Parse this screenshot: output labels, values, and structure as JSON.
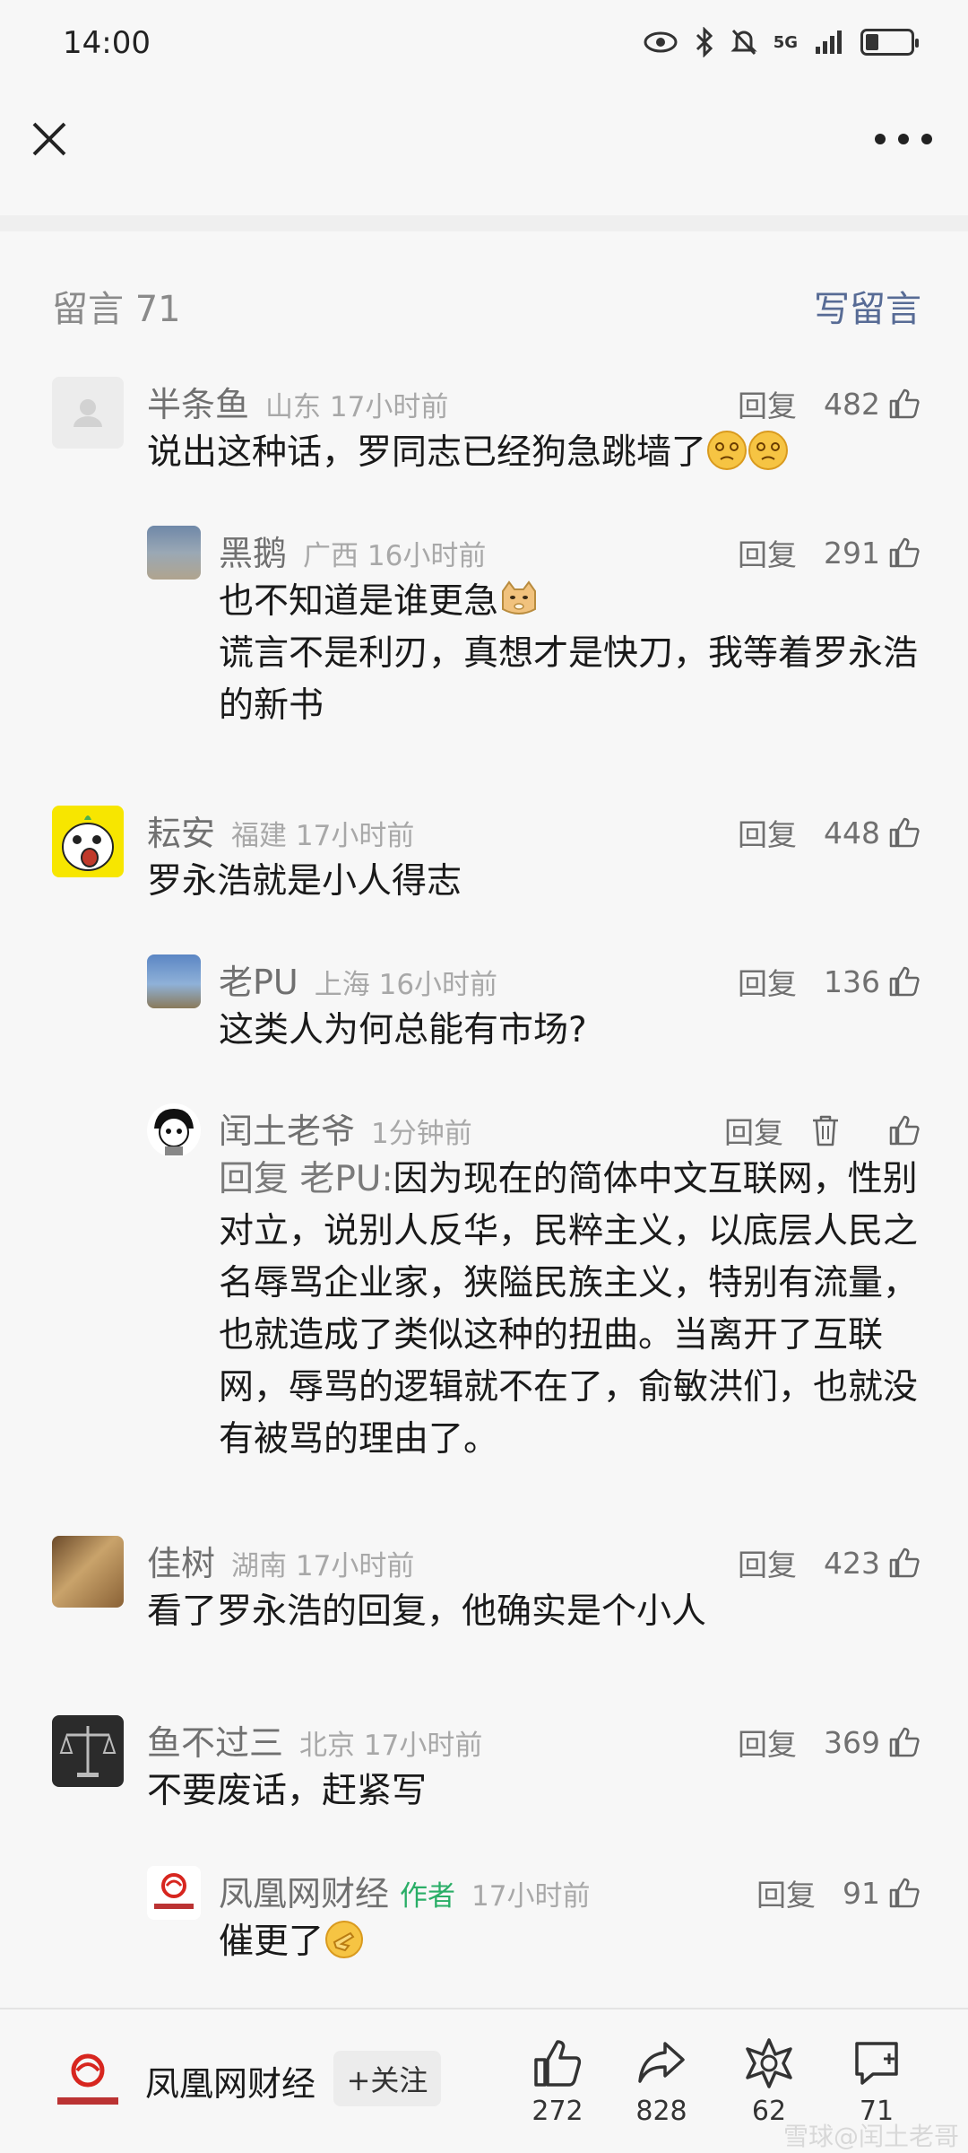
{
  "status_bar": {
    "time": "14:00",
    "network": "5G"
  },
  "comments_section": {
    "title": "留言 71",
    "write_label": "写留言"
  },
  "comments": [
    {
      "name": "半条鱼",
      "location": "山东",
      "time": "17小时前",
      "reply_label": "回复",
      "likes": "482",
      "text": "说出这种话，罗同志已经狗急跳墙了",
      "replies": [
        {
          "name": "黑鹅",
          "location": "广西",
          "time": "16小时前",
          "reply_label": "回复",
          "likes": "291",
          "line1": "也不知道是谁更急",
          "line2": "谎言不是利刃，真想才是快刀，我等着罗永浩的新书"
        }
      ]
    },
    {
      "name": "耘安",
      "location": "福建",
      "time": "17小时前",
      "reply_label": "回复",
      "likes": "448",
      "text": "罗永浩就是小人得志",
      "replies": [
        {
          "name": "老PU",
          "location": "上海",
          "time": "16小时前",
          "reply_label": "回复",
          "likes": "136",
          "text": "这类人为何总能有市场?"
        },
        {
          "name": "闰土老爷",
          "time": "1分钟前",
          "reply_label": "回复",
          "lead": "回复 老PU:",
          "text": "因为现在的简体中文互联网，性别对立，说别人反华，民粹主义，以底层人民之名辱骂企业家，狭隘民族主义，特别有流量，也就造成了类似这种的扭曲。当离开了互联网，辱骂的逻辑就不在了，俞敏洪们，也就没有被骂的理由了。"
        }
      ]
    },
    {
      "name": "佳树",
      "location": "湖南",
      "time": "17小时前",
      "reply_label": "回复",
      "likes": "423",
      "text": "看了罗永浩的回复，他确实是个小人"
    },
    {
      "name": "鱼不过三",
      "location": "北京",
      "time": "17小时前",
      "reply_label": "回复",
      "likes": "369",
      "text": "不要废话，赶紧写",
      "replies": [
        {
          "name": "凤凰网财经",
          "author_tag": "作者",
          "time": "17小时前",
          "reply_label": "回复",
          "likes": "91",
          "text": "催更了"
        }
      ]
    }
  ],
  "bottom_bar": {
    "account_name": "凤凰网财经",
    "follow_label": "+关注",
    "like_count": "272",
    "share_count": "828",
    "favorite_count": "62",
    "comment_count": "71"
  },
  "watermark": "雪球@闰土老哥",
  "colors": {
    "link": "#576b95",
    "author_tag": "#2aae67",
    "meta": "#a8a8a8",
    "background": "#f7f7f7"
  }
}
